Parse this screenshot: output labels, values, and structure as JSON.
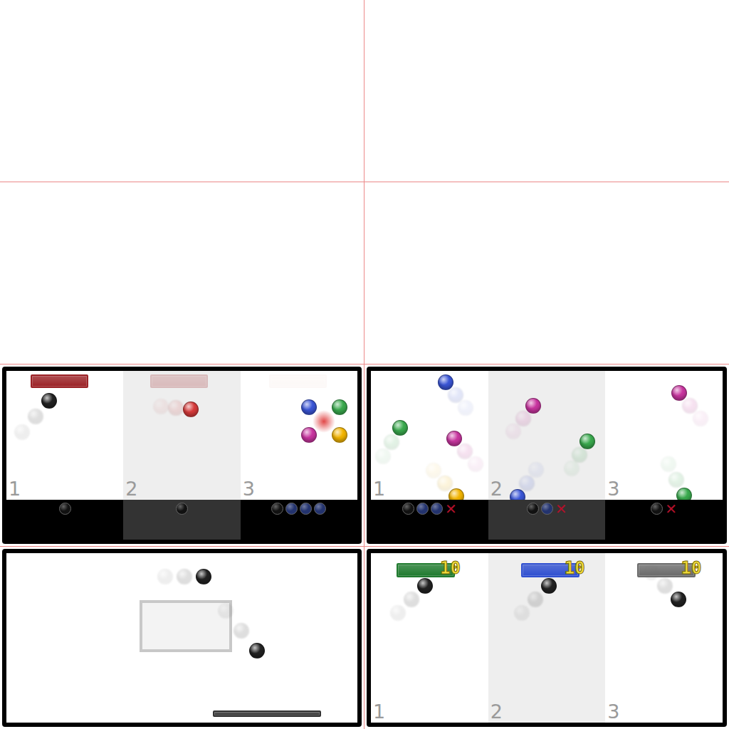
{
  "panels": [
    {
      "name": "catch-tutorial",
      "strip": true,
      "columns": [
        {
          "label": "1",
          "shaded": false,
          "paddle": {
            "color": "#9b2226",
            "faded": false
          },
          "balls": [
            {
              "color": "#222222",
              "trail": true
            }
          ],
          "burst": false,
          "tray": [
            {
              "kind": "ball",
              "color": "#111111"
            }
          ]
        },
        {
          "label": "2",
          "shaded": true,
          "paddle": {
            "color": "#9b2226",
            "faded": true
          },
          "balls": [
            {
              "color": "#d63a3a",
              "trail": true
            }
          ],
          "burst": false,
          "tray": [
            {
              "kind": "ball",
              "color": "#111111"
            }
          ]
        },
        {
          "label": "3",
          "shaded": false,
          "paddle": {
            "color": "#f4e6e0",
            "faded": true
          },
          "balls": [
            {
              "color": "#3a55d6",
              "trail": false
            },
            {
              "color": "#3aaa4e",
              "trail": false
            },
            {
              "color": "#c8359f",
              "trail": false
            },
            {
              "color": "#f2b400",
              "trail": false
            }
          ],
          "burst": true,
          "tray": [
            {
              "kind": "ball",
              "color": "#111111"
            },
            {
              "kind": "ball",
              "color": "#23336e"
            },
            {
              "kind": "ball",
              "color": "#23336e"
            },
            {
              "kind": "ball",
              "color": "#23336e"
            }
          ]
        }
      ]
    },
    {
      "name": "color-rain",
      "strip": true,
      "columns": [
        {
          "label": "1",
          "shaded": false,
          "balls": [
            {
              "color": "#3a55d6",
              "trail": true
            },
            {
              "color": "#3aaa4e",
              "trail": true
            },
            {
              "color": "#c8359f",
              "trail": true
            },
            {
              "color": "#f2b400",
              "trail": true
            }
          ],
          "burst": false,
          "tray": [
            {
              "kind": "ball",
              "color": "#111111"
            },
            {
              "kind": "ball",
              "color": "#23336e"
            },
            {
              "kind": "ball",
              "color": "#23336e"
            },
            {
              "kind": "miss",
              "text": "✕"
            }
          ]
        },
        {
          "label": "2",
          "shaded": true,
          "balls": [
            {
              "color": "#c8359f",
              "trail": true
            },
            {
              "color": "#3aaa4e",
              "trail": true
            },
            {
              "color": "#3a55d6",
              "trail": true
            }
          ],
          "burst": false,
          "tray": [
            {
              "kind": "ball",
              "color": "#111111"
            },
            {
              "kind": "ball",
              "color": "#23336e"
            },
            {
              "kind": "miss",
              "text": "✕"
            }
          ]
        },
        {
          "label": "3",
          "shaded": false,
          "balls": [
            {
              "color": "#c8359f",
              "trail": true
            },
            {
              "color": "#3aaa4e",
              "trail": true
            }
          ],
          "burst": false,
          "tray": [
            {
              "kind": "ball",
              "color": "#111111"
            },
            {
              "kind": "miss",
              "text": "✕"
            }
          ]
        }
      ]
    },
    {
      "name": "bounce-field",
      "strip": false,
      "columns": [
        {
          "label": "",
          "shaded": false,
          "box": true,
          "paddle": {
            "color": "#333333",
            "faded": false
          },
          "balls": [
            {
              "color": "#222222",
              "trail": true
            },
            {
              "color": "#222222",
              "trail": true
            }
          ],
          "burst": false,
          "tray": []
        }
      ]
    },
    {
      "name": "score-lanes",
      "strip": false,
      "columns": [
        {
          "label": "1",
          "shaded": false,
          "paddle": {
            "color": "#1f7a2e",
            "faded": false,
            "score": "10"
          },
          "balls": [
            {
              "color": "#222222",
              "trail": true
            }
          ],
          "burst": false,
          "tray": []
        },
        {
          "label": "2",
          "shaded": true,
          "paddle": {
            "color": "#2f4fd0",
            "faded": false,
            "score": "10"
          },
          "balls": [
            {
              "color": "#222222",
              "trail": true
            }
          ],
          "burst": false,
          "tray": []
        },
        {
          "label": "3",
          "shaded": false,
          "paddle": {
            "color": "#6a6a6a",
            "faded": false,
            "score": "10"
          },
          "balls": [
            {
              "color": "#222222",
              "trail": true
            }
          ],
          "burst": false,
          "tray": []
        }
      ]
    }
  ]
}
